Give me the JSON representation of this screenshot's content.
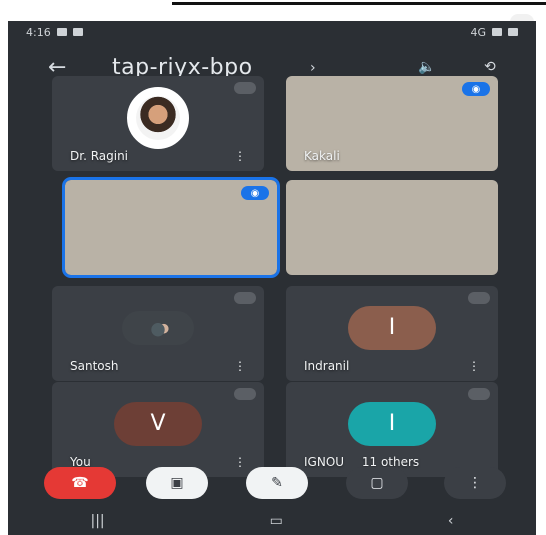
{
  "status_bar": {
    "time": "4:16",
    "right_text": "4G"
  },
  "header": {
    "back_icon": "back-arrow-icon",
    "meeting_code": "tap-riyx-bpo",
    "caret_icon": "chevron-right-icon",
    "icons": [
      "audio-output-icon",
      "switch-camera-icon"
    ]
  },
  "participants": [
    {
      "name": "Dr. Ragini",
      "type": "avatar-photo",
      "speaking": false,
      "menu_icon": "more-icon",
      "mute_icon": "mute-icon"
    },
    {
      "name": "Kakali",
      "type": "video",
      "speaking": true,
      "menu_icon": "speaking-icon"
    },
    {
      "name": "",
      "type": "video",
      "speaking": true,
      "active": true,
      "menu_icon": "speaking-icon"
    },
    {
      "name": "",
      "type": "video",
      "speaking": false,
      "menu_icon": ""
    },
    {
      "name": "Santosh",
      "type": "avatar-photo",
      "speaking": false,
      "menu_icon": "more-icon",
      "mute_icon": "mute-icon"
    },
    {
      "name": "Indranil",
      "type": "avatar-initial",
      "initial": "I",
      "speaking": false,
      "menu_icon": "more-icon",
      "mute_icon": "mute-icon",
      "avatar_color": "#8b5e4d"
    },
    {
      "name": "You",
      "type": "avatar-initial",
      "initial": "V",
      "speaking": false,
      "menu_icon": "more-icon",
      "mute_icon": "mute-icon",
      "avatar_color": "#6d3f36"
    },
    {
      "name": "IGNOU",
      "extra": "11 others",
      "type": "avatar-initial",
      "initial": "I",
      "speaking": false,
      "menu_icon": "more-icon",
      "avatar_color": "#1aa5a8"
    }
  ],
  "controls": [
    {
      "name": "end-call-button",
      "icon": "end-call-icon",
      "color": "#e53935"
    },
    {
      "name": "camera-button",
      "icon": "camera-off-icon",
      "color": "#f1f3f4"
    },
    {
      "name": "mic-button",
      "icon": "mic-off-icon",
      "color": "#f1f3f4"
    },
    {
      "name": "present-button",
      "icon": "present-icon",
      "color": "#3b3f45"
    },
    {
      "name": "more-button",
      "icon": "more-vertical-icon",
      "color": "#3b3f45"
    }
  ],
  "nav_bar": {
    "recent_icon": "recents-icon",
    "home_icon": "home-icon",
    "back_icon": "back-icon"
  }
}
